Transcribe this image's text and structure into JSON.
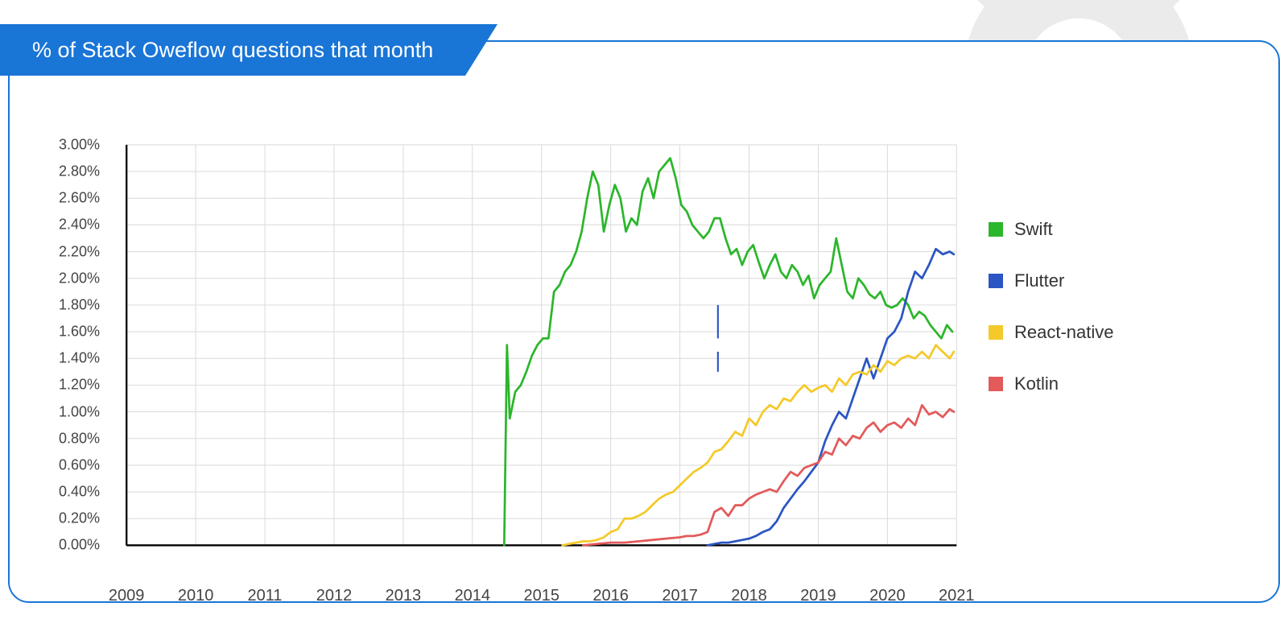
{
  "title": "% of Stack Oweflow questions that month",
  "legend": [
    {
      "name": "Swift",
      "color": "#2bb62b"
    },
    {
      "name": "Flutter",
      "color": "#2b55c2"
    },
    {
      "name": "React-native",
      "color": "#f4c92a"
    },
    {
      "name": "Kotlin",
      "color": "#e25a5a"
    }
  ],
  "chart_data": {
    "type": "line",
    "xlabel": "",
    "ylabel": "",
    "xlim": [
      2009,
      2021
    ],
    "ylim": [
      0,
      3.0
    ],
    "x_ticks": [
      2009,
      2010,
      2011,
      2012,
      2013,
      2014,
      2015,
      2016,
      2017,
      2018,
      2019,
      2020,
      2021
    ],
    "y_ticks": [
      0.0,
      0.2,
      0.4,
      0.6,
      0.8,
      1.0,
      1.2,
      1.4,
      1.6,
      1.8,
      2.0,
      2.2,
      2.4,
      2.6,
      2.8,
      3.0
    ],
    "y_tick_format": "{v}%",
    "series": [
      {
        "name": "Swift",
        "color": "#2bb62b",
        "x": [
          2014.46,
          2014.5,
          2014.54,
          2014.58,
          2014.62,
          2014.7,
          2014.78,
          2014.86,
          2014.94,
          2015.02,
          2015.1,
          2015.18,
          2015.26,
          2015.34,
          2015.42,
          2015.5,
          2015.58,
          2015.66,
          2015.74,
          2015.82,
          2015.9,
          2015.98,
          2016.06,
          2016.14,
          2016.22,
          2016.3,
          2016.38,
          2016.46,
          2016.54,
          2016.62,
          2016.7,
          2016.78,
          2016.86,
          2016.94,
          2017.02,
          2017.1,
          2017.18,
          2017.26,
          2017.34,
          2017.42,
          2017.5,
          2017.58,
          2017.66,
          2017.74,
          2017.82,
          2017.9,
          2017.98,
          2018.06,
          2018.14,
          2018.22,
          2018.3,
          2018.38,
          2018.46,
          2018.54,
          2018.62,
          2018.7,
          2018.78,
          2018.86,
          2018.94,
          2019.02,
          2019.1,
          2019.18,
          2019.26,
          2019.34,
          2019.42,
          2019.5,
          2019.58,
          2019.66,
          2019.74,
          2019.82,
          2019.9,
          2019.98,
          2020.06,
          2020.14,
          2020.22,
          2020.3,
          2020.38,
          2020.46,
          2020.54,
          2020.62,
          2020.7,
          2020.78,
          2020.86,
          2020.94
        ],
        "y": [
          0.0,
          1.5,
          0.95,
          1.05,
          1.15,
          1.2,
          1.3,
          1.42,
          1.5,
          1.55,
          1.55,
          1.9,
          1.95,
          2.05,
          2.1,
          2.2,
          2.35,
          2.6,
          2.8,
          2.7,
          2.35,
          2.55,
          2.7,
          2.6,
          2.35,
          2.45,
          2.4,
          2.65,
          2.75,
          2.6,
          2.8,
          2.85,
          2.9,
          2.75,
          2.55,
          2.5,
          2.4,
          2.35,
          2.3,
          2.35,
          2.45,
          2.45,
          2.3,
          2.18,
          2.22,
          2.1,
          2.2,
          2.25,
          2.12,
          2.0,
          2.1,
          2.18,
          2.05,
          2.0,
          2.1,
          2.05,
          1.95,
          2.02,
          1.85,
          1.95,
          2.0,
          2.05,
          2.3,
          2.1,
          1.9,
          1.85,
          2.0,
          1.95,
          1.88,
          1.85,
          1.9,
          1.8,
          1.78,
          1.8,
          1.85,
          1.8,
          1.7,
          1.75,
          1.72,
          1.65,
          1.6,
          1.55,
          1.65,
          1.6
        ]
      },
      {
        "name": "Flutter",
        "color": "#2b55c2",
        "x": [
          2017.4,
          2017.5,
          2017.6,
          2017.7,
          2017.8,
          2017.9,
          2018.0,
          2018.1,
          2018.2,
          2018.3,
          2018.4,
          2018.5,
          2018.6,
          2018.7,
          2018.8,
          2018.9,
          2019.0,
          2019.1,
          2019.2,
          2019.3,
          2019.4,
          2019.5,
          2019.6,
          2019.7,
          2019.8,
          2019.9,
          2020.0,
          2020.1,
          2020.2,
          2020.3,
          2020.4,
          2020.5,
          2020.6,
          2020.7,
          2020.8,
          2020.9,
          2020.96
        ],
        "y": [
          0.0,
          0.01,
          0.02,
          0.02,
          0.03,
          0.04,
          0.05,
          0.07,
          0.1,
          0.12,
          0.18,
          0.28,
          0.35,
          0.42,
          0.48,
          0.55,
          0.62,
          0.78,
          0.9,
          1.0,
          0.95,
          1.1,
          1.25,
          1.4,
          1.25,
          1.4,
          1.55,
          1.6,
          1.7,
          1.9,
          2.05,
          2.0,
          2.1,
          2.22,
          2.18,
          2.2,
          2.18
        ]
      },
      {
        "name": "React-native",
        "color": "#f4c92a",
        "x": [
          2015.3,
          2015.4,
          2015.5,
          2015.6,
          2015.7,
          2015.8,
          2015.9,
          2016.0,
          2016.1,
          2016.2,
          2016.3,
          2016.4,
          2016.5,
          2016.6,
          2016.7,
          2016.8,
          2016.9,
          2017.0,
          2017.1,
          2017.2,
          2017.3,
          2017.4,
          2017.5,
          2017.6,
          2017.7,
          2017.8,
          2017.9,
          2018.0,
          2018.1,
          2018.2,
          2018.3,
          2018.4,
          2018.5,
          2018.6,
          2018.7,
          2018.8,
          2018.9,
          2019.0,
          2019.1,
          2019.2,
          2019.3,
          2019.4,
          2019.5,
          2019.6,
          2019.7,
          2019.8,
          2019.9,
          2020.0,
          2020.1,
          2020.2,
          2020.3,
          2020.4,
          2020.5,
          2020.6,
          2020.7,
          2020.8,
          2020.9,
          2020.96
        ],
        "y": [
          0.0,
          0.01,
          0.02,
          0.03,
          0.03,
          0.04,
          0.06,
          0.1,
          0.12,
          0.2,
          0.2,
          0.22,
          0.25,
          0.3,
          0.35,
          0.38,
          0.4,
          0.45,
          0.5,
          0.55,
          0.58,
          0.62,
          0.7,
          0.72,
          0.78,
          0.85,
          0.82,
          0.95,
          0.9,
          1.0,
          1.05,
          1.02,
          1.1,
          1.08,
          1.15,
          1.2,
          1.15,
          1.18,
          1.2,
          1.15,
          1.25,
          1.2,
          1.28,
          1.3,
          1.28,
          1.35,
          1.3,
          1.38,
          1.35,
          1.4,
          1.42,
          1.4,
          1.45,
          1.4,
          1.5,
          1.45,
          1.4,
          1.45
        ]
      },
      {
        "name": "Kotlin",
        "color": "#e25a5a",
        "x": [
          2015.6,
          2015.8,
          2016.0,
          2016.2,
          2016.4,
          2016.6,
          2016.8,
          2017.0,
          2017.1,
          2017.2,
          2017.3,
          2017.4,
          2017.5,
          2017.6,
          2017.7,
          2017.8,
          2017.9,
          2018.0,
          2018.1,
          2018.2,
          2018.3,
          2018.4,
          2018.5,
          2018.6,
          2018.7,
          2018.8,
          2018.9,
          2019.0,
          2019.1,
          2019.2,
          2019.3,
          2019.4,
          2019.5,
          2019.6,
          2019.7,
          2019.8,
          2019.9,
          2020.0,
          2020.1,
          2020.2,
          2020.3,
          2020.4,
          2020.5,
          2020.6,
          2020.7,
          2020.8,
          2020.9,
          2020.96
        ],
        "y": [
          0.0,
          0.01,
          0.02,
          0.02,
          0.03,
          0.04,
          0.05,
          0.06,
          0.07,
          0.07,
          0.08,
          0.1,
          0.25,
          0.28,
          0.22,
          0.3,
          0.3,
          0.35,
          0.38,
          0.4,
          0.42,
          0.4,
          0.48,
          0.55,
          0.52,
          0.58,
          0.6,
          0.62,
          0.7,
          0.68,
          0.8,
          0.75,
          0.82,
          0.8,
          0.88,
          0.92,
          0.85,
          0.9,
          0.92,
          0.88,
          0.95,
          0.9,
          1.05,
          0.98,
          1.0,
          0.96,
          1.02,
          1.0
        ]
      }
    ]
  }
}
